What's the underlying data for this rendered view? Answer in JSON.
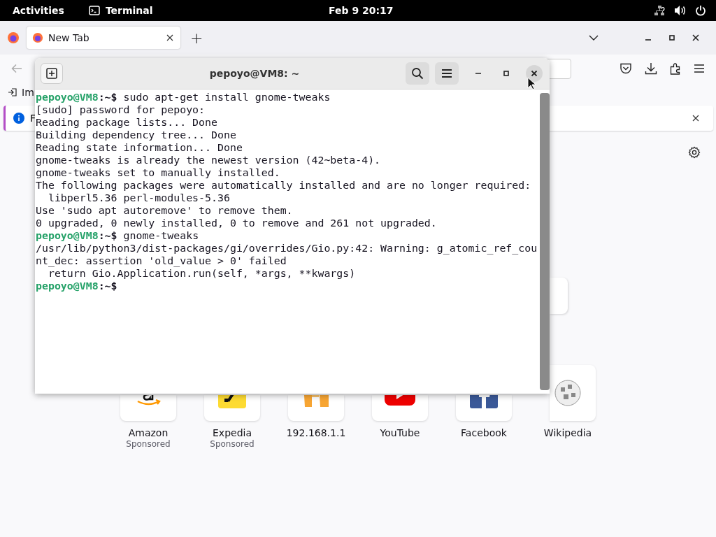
{
  "top_bar": {
    "activities": "Activities",
    "app": "Terminal",
    "clock": "Feb 9  20:17"
  },
  "browser": {
    "tabs": [
      {
        "label": "New Tab",
        "selected": true
      }
    ],
    "new_tab": "+",
    "bookmarks": [
      {
        "label": "Im"
      }
    ],
    "notification": {
      "text": "F"
    },
    "shortcuts": [
      {
        "label": "Amazon",
        "sublabel": "Sponsored"
      },
      {
        "label": "Expedia",
        "sublabel": "Sponsored"
      },
      {
        "label": "192.168.1.1"
      },
      {
        "label": "YouTube"
      },
      {
        "label": "Facebook"
      },
      {
        "label": "Wikipedia"
      }
    ]
  },
  "terminal": {
    "title": "pepoyo@VM8: ~",
    "lines": [
      {
        "kind": "prompt",
        "user": "pepoyo@VM8",
        "cwd": ":~$",
        "text": " sudo apt-get install gnome-tweaks"
      },
      {
        "kind": "output",
        "text": "[sudo] password for pepoyo:"
      },
      {
        "kind": "output",
        "text": "Reading package lists... Done"
      },
      {
        "kind": "output",
        "text": "Building dependency tree... Done"
      },
      {
        "kind": "output",
        "text": "Reading state information... Done"
      },
      {
        "kind": "output",
        "text": "gnome-tweaks is already the newest version (42~beta-4)."
      },
      {
        "kind": "output",
        "text": "gnome-tweaks set to manually installed."
      },
      {
        "kind": "output",
        "text": "The following packages were automatically installed and are no longer required:"
      },
      {
        "kind": "output",
        "text": "  libperl5.36 perl-modules-5.36"
      },
      {
        "kind": "output",
        "text": "Use 'sudo apt autoremove' to remove them."
      },
      {
        "kind": "output",
        "text": "0 upgraded, 0 newly installed, 0 to remove and 261 not upgraded."
      },
      {
        "kind": "prompt",
        "user": "pepoyo@VM8",
        "cwd": ":~$",
        "text": " gnome-tweaks"
      },
      {
        "kind": "output",
        "text": "/usr/lib/python3/dist-packages/gi/overrides/Gio.py:42: Warning: g_atomic_ref_cou"
      },
      {
        "kind": "output",
        "text": "nt_dec: assertion 'old_value > 0' failed"
      },
      {
        "kind": "output",
        "text": "  return Gio.Application.run(self, *args, **kwargs)"
      },
      {
        "kind": "prompt",
        "user": "pepoyo@VM8",
        "cwd": ":~$"
      }
    ]
  }
}
